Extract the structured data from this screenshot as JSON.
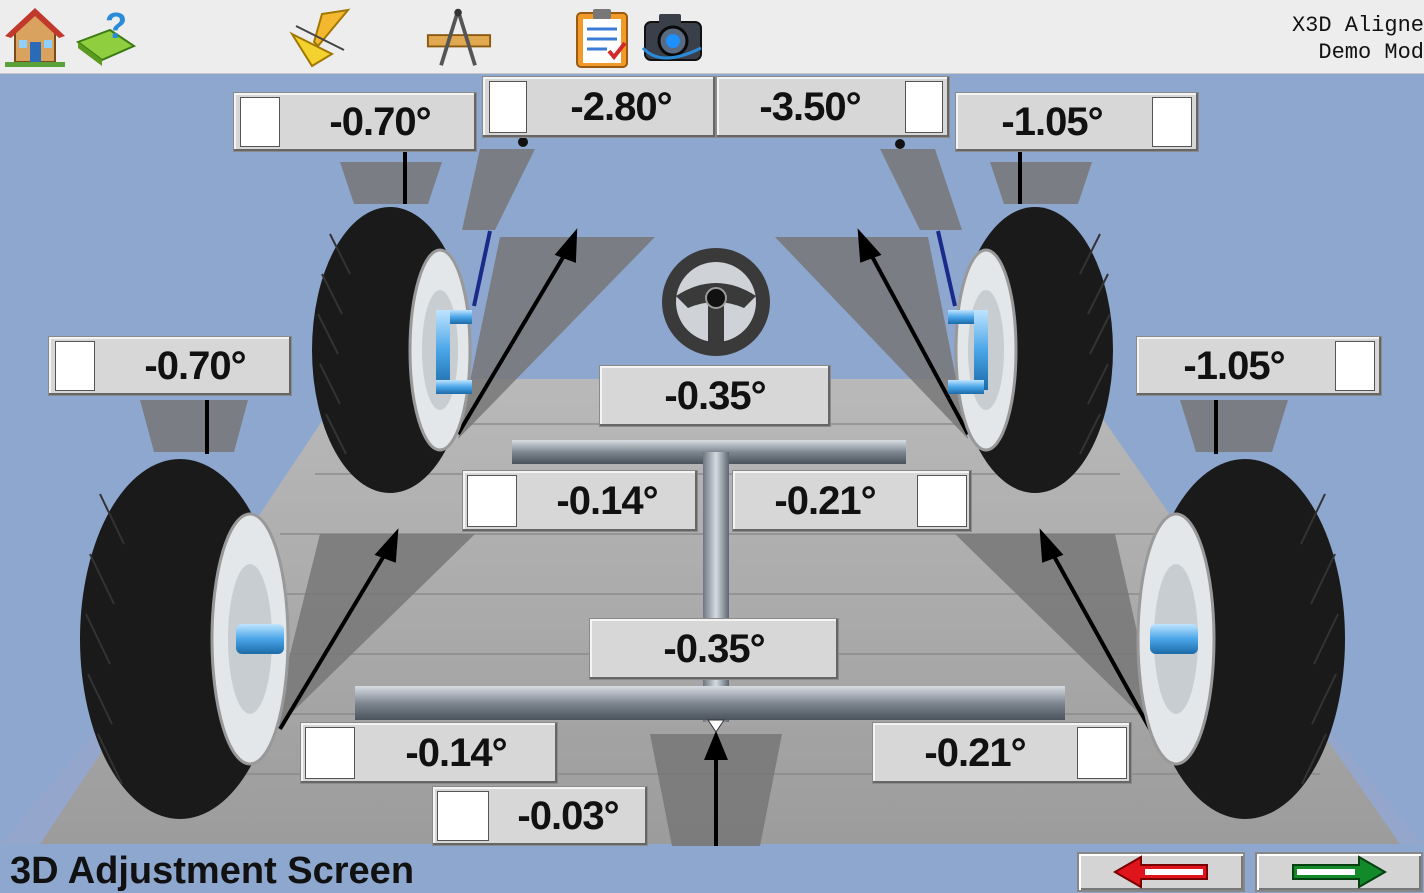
{
  "window": {
    "title_line1": "X3D Aligne",
    "title_line2": "Demo Mod"
  },
  "toolbar": {
    "items": [
      {
        "name": "home-icon"
      },
      {
        "name": "help-book-icon"
      },
      {
        "name": "drafting-tools-icon"
      },
      {
        "name": "compass-ruler-icon"
      },
      {
        "name": "clipboard-report-icon"
      },
      {
        "name": "camera-icon"
      }
    ]
  },
  "readings": {
    "front_left_top": "-0.70°",
    "front_left_caster": "-2.80°",
    "front_right_caster": "-3.50°",
    "front_right_top": "-1.05°",
    "rear_left_camber": "-0.70°",
    "rear_right_camber": "-1.05°",
    "steering": "-0.35°",
    "front_left_toe": "-0.14°",
    "front_right_toe": "-0.21°",
    "thrust": "-0.35°",
    "rear_left_toe": "-0.14°",
    "rear_right_toe": "-0.21°",
    "setback": "-0.03°"
  },
  "footer": {
    "screen_title": "3D Adjustment Screen"
  },
  "colors": {
    "background": "#8ea7cf",
    "back_arrow": "#e0141c",
    "next_arrow": "#138a2a",
    "panel": "#d7d7d7"
  }
}
